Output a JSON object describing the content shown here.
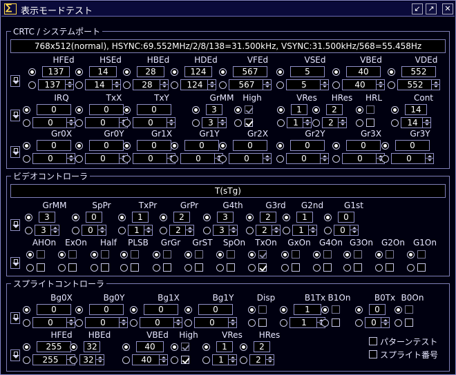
{
  "window": {
    "title": "表示モードテスト",
    "icon_glyph": "∑"
  },
  "crtc": {
    "title": "CRTC / システムポート",
    "info": "768x512(normal), HSYNC:69.552MHz/2/8/138=31.500kHz, VSYNC:31.500kHz/568=55.458Hz",
    "row1": [
      {
        "label": "HFEd",
        "value": "137",
        "edit": "137"
      },
      {
        "label": "HSEd",
        "value": "14",
        "edit": "14"
      },
      {
        "label": "HBEd",
        "value": "28",
        "edit": "28"
      },
      {
        "label": "HDEd",
        "value": "124",
        "edit": "124"
      },
      {
        "label": "VFEd",
        "value": "567",
        "edit": "567"
      },
      {
        "label": "VSEd",
        "value": "5",
        "edit": "5"
      },
      {
        "label": "VBEd",
        "value": "40",
        "edit": "40"
      },
      {
        "label": "VDEd",
        "value": "552",
        "edit": "552"
      }
    ],
    "row2": [
      {
        "label": "IRQ",
        "value": "0",
        "edit": "0"
      },
      {
        "label": "TxX",
        "value": "0",
        "edit": "0"
      },
      {
        "label": "TxY",
        "value": "0",
        "edit": "0"
      },
      {
        "label": "GrMM",
        "value": "3",
        "edit": "3"
      },
      {
        "label": "High",
        "checked": true
      },
      {
        "label": "VRes",
        "value": "1",
        "edit": "1"
      },
      {
        "label": "HRes",
        "value": "2",
        "edit": "2"
      },
      {
        "label": "HRL",
        "checked": false
      },
      {
        "label": "Cont",
        "value": "14",
        "edit": "14"
      }
    ],
    "row3": [
      {
        "label": "Gr0X",
        "value": "0",
        "edit": "0"
      },
      {
        "label": "Gr0Y",
        "value": "0",
        "edit": "0"
      },
      {
        "label": "Gr1X",
        "value": "0",
        "edit": "0"
      },
      {
        "label": "Gr1Y",
        "value": "0",
        "edit": "0"
      },
      {
        "label": "Gr2X",
        "value": "0",
        "edit": "0"
      },
      {
        "label": "Gr2Y",
        "value": "0",
        "edit": "0"
      },
      {
        "label": "Gr3X",
        "value": "0",
        "edit": "0"
      },
      {
        "label": "Gr3Y",
        "value": "0",
        "edit": "0"
      }
    ]
  },
  "video": {
    "title": "ビデオコントローラ",
    "info": "T(sTg)",
    "row1": [
      {
        "label": "GrMM",
        "value": "3",
        "edit": "3"
      },
      {
        "label": "SpPr",
        "value": "0",
        "edit": "0"
      },
      {
        "label": "TxPr",
        "value": "1",
        "edit": "1"
      },
      {
        "label": "GrPr",
        "value": "2",
        "edit": "2"
      },
      {
        "label": "G4th",
        "value": "3",
        "edit": "3"
      },
      {
        "label": "G3rd",
        "value": "2",
        "edit": "2"
      },
      {
        "label": "G2nd",
        "value": "1",
        "edit": "1"
      },
      {
        "label": "G1st",
        "value": "0",
        "edit": "0"
      }
    ],
    "row2": [
      {
        "label": "AHOn",
        "checked": false
      },
      {
        "label": "ExOn",
        "checked": false
      },
      {
        "label": "Half",
        "checked": false
      },
      {
        "label": "PLSB",
        "checked": false
      },
      {
        "label": "GrGr",
        "checked": false
      },
      {
        "label": "GrST",
        "checked": false
      },
      {
        "label": "SpOn",
        "checked": false
      },
      {
        "label": "TxOn",
        "checked": true
      },
      {
        "label": "GxOn",
        "checked": false
      },
      {
        "label": "G4On",
        "checked": false
      },
      {
        "label": "G3On",
        "checked": false
      },
      {
        "label": "G2On",
        "checked": false
      },
      {
        "label": "G1On",
        "checked": false
      }
    ]
  },
  "sprite": {
    "title": "スプライトコントローラ",
    "row1": [
      {
        "label": "Bg0X",
        "value": "0",
        "edit": "0"
      },
      {
        "label": "Bg0Y",
        "value": "0",
        "edit": "0"
      },
      {
        "label": "Bg1X",
        "value": "0",
        "edit": "0"
      },
      {
        "label": "Bg1Y",
        "value": "0",
        "edit": "0"
      },
      {
        "label": "Disp",
        "checked": false
      },
      {
        "label": "B1Tx",
        "value": "1",
        "edit": "1"
      },
      {
        "label": "B1On",
        "checked": false
      },
      {
        "label": "B0Tx",
        "value": "0",
        "edit": "0"
      },
      {
        "label": "B0On",
        "checked": false
      }
    ],
    "row2": [
      {
        "label": "HFEd",
        "value": "255",
        "edit": "255"
      },
      {
        "label": "HBEd",
        "value": "32",
        "edit": "32"
      },
      {
        "label": "VBEd",
        "value": "40",
        "edit": "40"
      },
      {
        "label": "High",
        "checked": true
      },
      {
        "label": "VRes",
        "value": "1",
        "edit": "1"
      },
      {
        "label": "HRes",
        "value": "2",
        "edit": "2"
      }
    ],
    "pattern_test": "パターンテスト",
    "sprite_number": "スプライト番号"
  }
}
